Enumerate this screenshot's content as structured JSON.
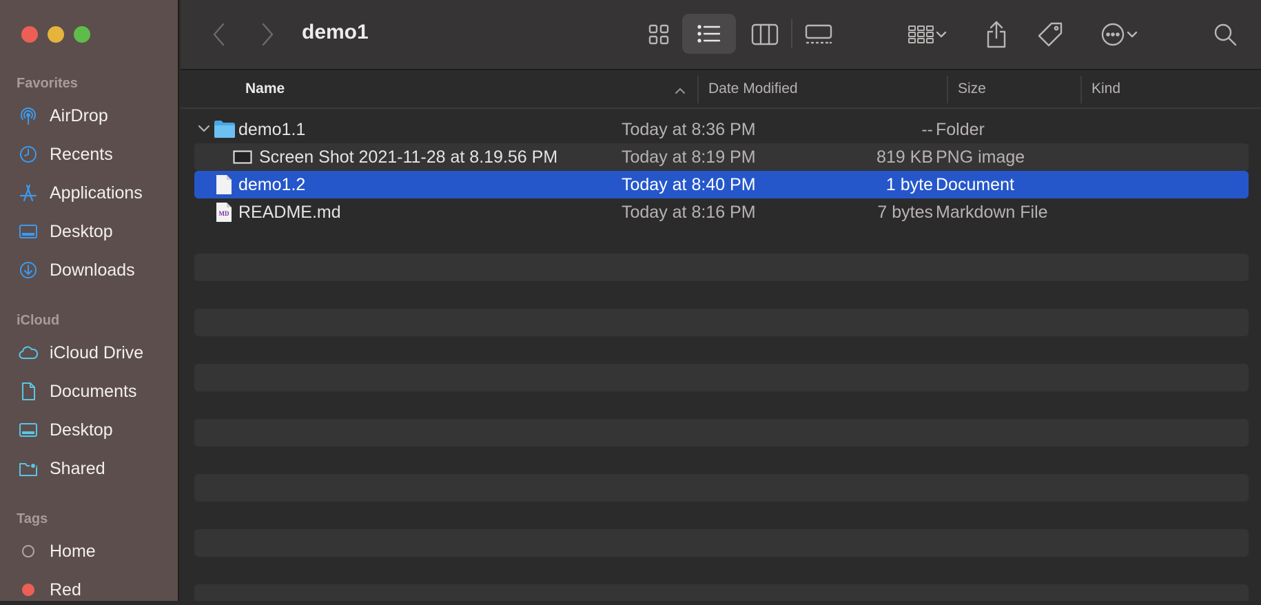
{
  "window": {
    "title": "demo1"
  },
  "sidebar": {
    "favorites_title": "Favorites",
    "favorites": [
      {
        "label": "AirDrop",
        "icon": "airdrop-icon"
      },
      {
        "label": "Recents",
        "icon": "clock-icon"
      },
      {
        "label": "Applications",
        "icon": "applications-icon"
      },
      {
        "label": "Desktop",
        "icon": "desktop-icon"
      },
      {
        "label": "Downloads",
        "icon": "download-icon"
      }
    ],
    "icloud_title": "iCloud",
    "icloud": [
      {
        "label": "iCloud Drive",
        "icon": "cloud-icon"
      },
      {
        "label": "Documents",
        "icon": "document-icon"
      },
      {
        "label": "Desktop",
        "icon": "desktop-icon"
      },
      {
        "label": "Shared",
        "icon": "shared-folder-icon"
      }
    ],
    "tags_title": "Tags",
    "tags": [
      {
        "label": "Home",
        "color": "#9a9a9a"
      },
      {
        "label": "Red",
        "color": "#ec5f56"
      }
    ]
  },
  "columns": {
    "name": "Name",
    "date": "Date Modified",
    "size": "Size",
    "kind": "Kind"
  },
  "files": [
    {
      "name": "demo1.1",
      "date": "Today at 8:36 PM",
      "size": "--",
      "kind": "Folder",
      "icon": "folder-icon",
      "expanded": true
    },
    {
      "name": "Screen Shot 2021-11-28 at 8.19.56 PM",
      "date": "Today at 8:19 PM",
      "size": "819 KB",
      "kind": "PNG image",
      "icon": "screenshot-icon"
    },
    {
      "name": "demo1.2",
      "date": "Today at 8:40 PM",
      "size": "1 byte",
      "kind": "Document",
      "icon": "file-icon",
      "selected": true
    },
    {
      "name": "README.md",
      "date": "Today at 8:16 PM",
      "size": "7 bytes",
      "kind": "Markdown File",
      "icon": "markdown-file-icon",
      "icon_text": "MD"
    }
  ],
  "colors": {
    "selection": "#2557cb",
    "sidebar_bg": "#5c4e4c",
    "accent_icon": "#3b9af0"
  }
}
